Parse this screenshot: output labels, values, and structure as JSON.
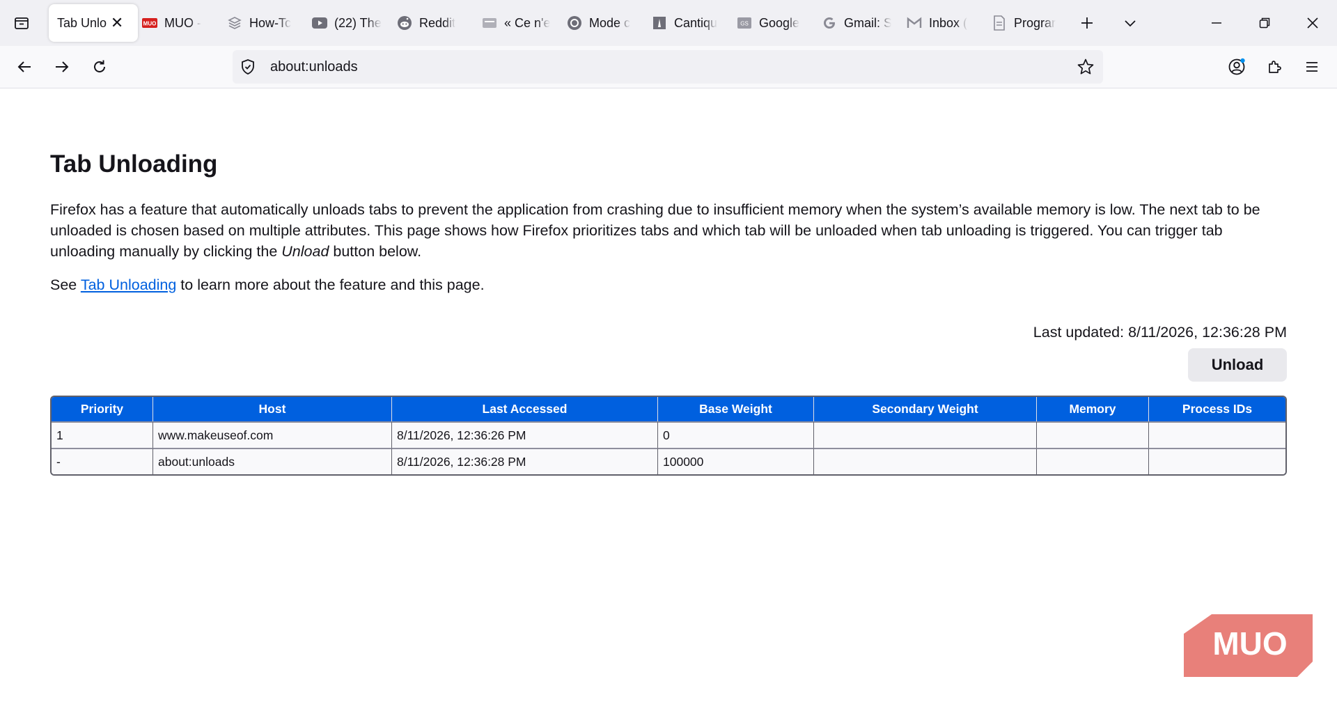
{
  "tabs": [
    {
      "title": "Tab Unlo",
      "active": true,
      "icon": "none",
      "close": "✕"
    },
    {
      "title": "MUO -",
      "icon": "muo-icon"
    },
    {
      "title": "How-Tc",
      "icon": "howto-icon"
    },
    {
      "title": "(22) The",
      "icon": "youtube-icon"
    },
    {
      "title": "Reddit",
      "icon": "reddit-icon"
    },
    {
      "title": "« Ce n'e",
      "icon": "generic-site-icon"
    },
    {
      "title": "Mode c",
      "icon": "threads-icon"
    },
    {
      "title": "Cantiqu",
      "icon": "cantique-icon"
    },
    {
      "title": "Google",
      "icon": "google-site-icon"
    },
    {
      "title": "Gmail: S",
      "icon": "google-icon"
    },
    {
      "title": "Inbox (",
      "icon": "gmail-icon"
    },
    {
      "title": "Prograr",
      "icon": "document-icon"
    }
  ],
  "address_bar": {
    "url": "about:unloads"
  },
  "page": {
    "title": "Tab Unloading",
    "description_part1": "Firefox has a feature that automatically unloads tabs to prevent the application from crashing due to insufficient memory when the system’s available memory is low. The next tab to be unloaded is chosen based on multiple attributes. This page shows how Firefox prioritizes tabs and which tab will be unloaded when tab unloading is triggered. You can trigger tab unloading manually by clicking the ",
    "description_emphasis": "Unload",
    "description_part2": " button below.",
    "see_prefix": "See ",
    "see_link": "Tab Unloading",
    "see_suffix": " to learn more about the feature and this page.",
    "last_updated": "Last updated: 8/11/2026, 12:36:28 PM",
    "unload_button": "Unload"
  },
  "table": {
    "headers": [
      "Priority",
      "Host",
      "Last Accessed",
      "Base Weight",
      "Secondary Weight",
      "Memory",
      "Process IDs"
    ],
    "rows": [
      [
        "1",
        "www.makeuseof.com",
        "8/11/2026, 12:36:26 PM",
        "0",
        "",
        "",
        ""
      ],
      [
        "-",
        "about:unloads",
        "8/11/2026, 12:36:28 PM",
        "100000",
        "",
        "",
        ""
      ]
    ]
  },
  "watermark": {
    "text": "MUO"
  },
  "colors": {
    "header_blue": "#0060df",
    "link": "#0060df",
    "watermark": "#e8807a"
  }
}
